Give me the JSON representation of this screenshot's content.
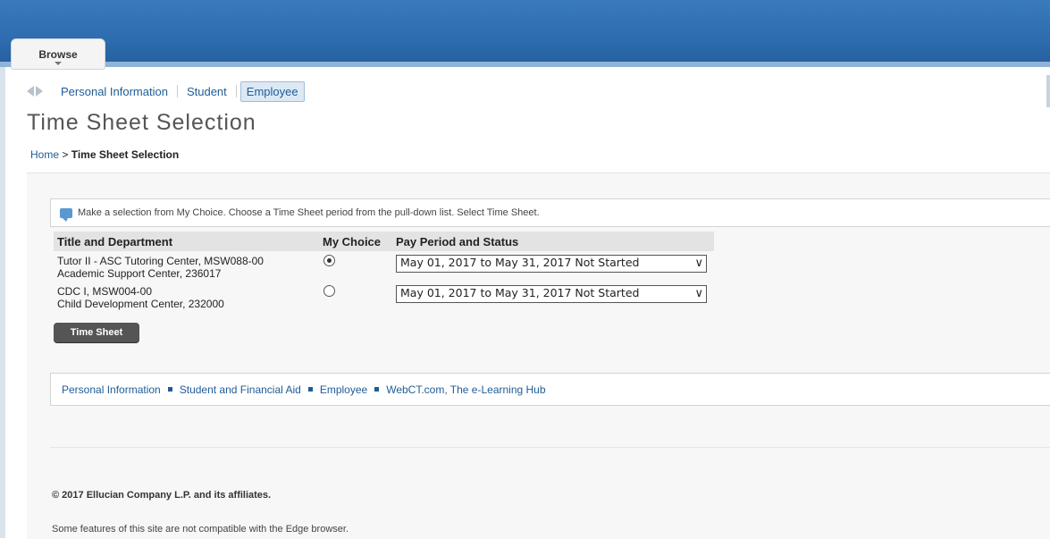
{
  "header": {
    "browse_tab": "Browse"
  },
  "nav": {
    "items": [
      "Personal Information",
      "Student",
      "Employee"
    ],
    "active": "Employee"
  },
  "page": {
    "title": "Time Sheet Selection"
  },
  "breadcrumb": {
    "home": "Home",
    "separator": ">",
    "current": "Time Sheet Selection"
  },
  "info": {
    "message": "Make a selection from My Choice. Choose a Time Sheet period from the pull-down list. Select Time Sheet."
  },
  "table": {
    "headers": [
      "Title and Department",
      "My Choice",
      "Pay Period and Status"
    ],
    "rows": [
      {
        "title": "Tutor II - ASC Tutoring Center, MSW088-00",
        "dept": "Academic Support Center, 236017",
        "selected": true,
        "pay_period": "May 01, 2017 to May 31, 2017 Not Started"
      },
      {
        "title": "CDC I, MSW004-00",
        "dept": "Child Development Center, 232000",
        "selected": false,
        "pay_period": "May 01, 2017 to May 31, 2017 Not Started"
      }
    ]
  },
  "buttons": {
    "time_sheet": "Time Sheet"
  },
  "footer_links": [
    "Personal Information",
    "Student and Financial Aid",
    "Employee",
    "WebCT.com, The e-Learning Hub"
  ],
  "footer": {
    "copyright": "© 2017 Ellucian Company L.P. and its affiliates.",
    "note": "Some features of this site are not compatible with the Edge browser."
  },
  "colors": {
    "header_blue": "#2d6cae",
    "link": "#1f5c96",
    "button": "#555555"
  }
}
